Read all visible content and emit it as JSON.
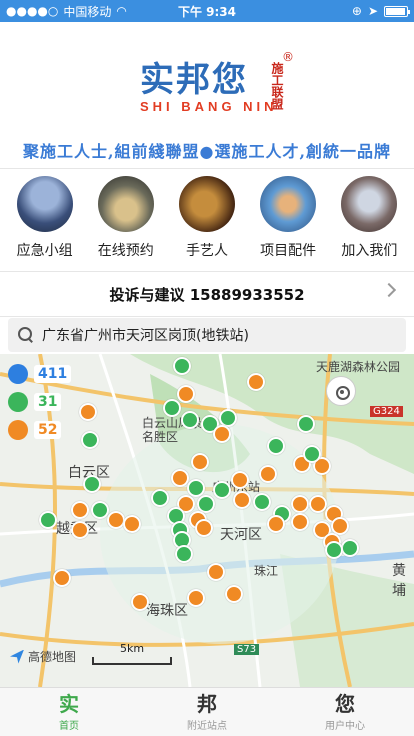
{
  "status": {
    "carrier": "中国移动",
    "time": "下午 9:34"
  },
  "banner": {
    "logo_main": "实邦您",
    "logo_sub": "SHI BANG NIN",
    "logo_side": "施工联盟",
    "logo_reg": "®",
    "slogan_left": "聚施工人士,組前綫聯盟",
    "slogan_right": "選施工人才,創統一品牌"
  },
  "shortcuts": [
    {
      "label": "应急小组",
      "icon": "team-photo"
    },
    {
      "label": "在线预约",
      "icon": "booking-photo"
    },
    {
      "label": "手艺人",
      "icon": "craftsman-photo"
    },
    {
      "label": "项目配件",
      "icon": "parts-photo"
    },
    {
      "label": "加入我们",
      "icon": "join-photo"
    }
  ],
  "complaint": {
    "text": "投诉与建议 15889933552"
  },
  "search": {
    "value": "广东省广州市天河区岗顶(地铁站)"
  },
  "map": {
    "stats": [
      {
        "value": "411",
        "color": "#2d7fe0"
      },
      {
        "value": "31",
        "color": "#3bb55b"
      },
      {
        "value": "52",
        "color": "#f08a24"
      }
    ],
    "labels": [
      "天鹿湖森林公园",
      "白云山风景名胜区",
      "白云区",
      "越秀区",
      "天河区",
      "海珠区",
      "黄埔",
      "G324",
      "S73",
      "珠江",
      "广州东站"
    ],
    "provider": "高德地图",
    "scale": "5km"
  },
  "tabs": [
    {
      "icon": "实",
      "label": "首页"
    },
    {
      "icon": "邦",
      "label": "附近站点"
    },
    {
      "icon": "您",
      "label": "用户中心"
    }
  ]
}
